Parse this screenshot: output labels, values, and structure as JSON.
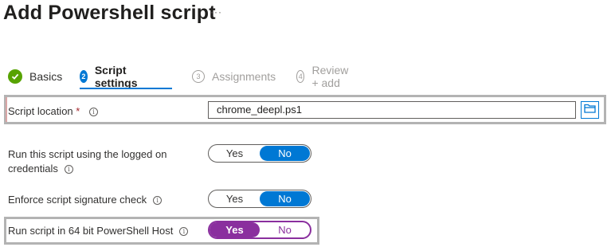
{
  "header": {
    "title": "Add Powershell script",
    "more": "···"
  },
  "steps": [
    {
      "num": "✓",
      "label": "Basics"
    },
    {
      "num": "2",
      "label": "Script settings"
    },
    {
      "num": "3",
      "label": "Assignments"
    },
    {
      "num": "4",
      "label": "Review + add"
    }
  ],
  "script_location": {
    "label": "Script location",
    "required": "*",
    "info": "i",
    "value": "chrome_deepl.ps1"
  },
  "logged_on": {
    "label_line1": "Run this script using the logged on",
    "label_line2": "credentials",
    "info": "i",
    "yes": "Yes",
    "no": "No",
    "selected": "No"
  },
  "signature_check": {
    "label": "Enforce script signature check",
    "info": "i",
    "yes": "Yes",
    "no": "No",
    "selected": "No"
  },
  "run_64bit": {
    "label": "Run script in 64 bit PowerShell Host",
    "info": "i",
    "yes": "Yes",
    "no": "No",
    "selected": "Yes"
  },
  "colors": {
    "accent": "#0078d4",
    "success": "#57a300",
    "highlight_purple": "#8a2f9e",
    "required": "#a4262c"
  },
  "icons": {
    "browse": "folder-icon",
    "info": "info-icon",
    "done": "checkmark-icon"
  }
}
